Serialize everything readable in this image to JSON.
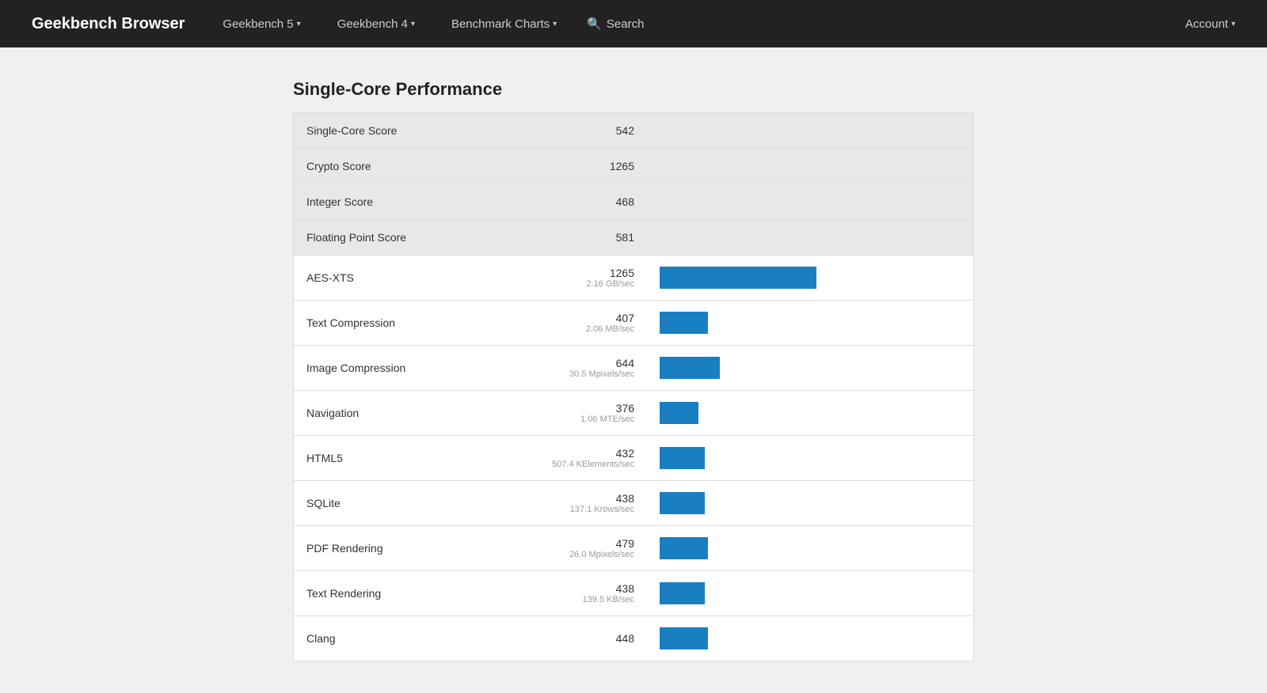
{
  "navbar": {
    "brand": "Geekbench Browser",
    "items": [
      {
        "id": "geekbench5",
        "label": "Geekbench 5",
        "hasDropdown": true
      },
      {
        "id": "geekbench4",
        "label": "Geekbench 4",
        "hasDropdown": true
      },
      {
        "id": "benchmark-charts",
        "label": "Benchmark Charts",
        "hasDropdown": true
      }
    ],
    "search_label": "Search",
    "account_label": "Account"
  },
  "section": {
    "title": "Single-Core Performance"
  },
  "summary_rows": [
    {
      "name": "Single-Core Score",
      "score": "542",
      "unit": ""
    },
    {
      "name": "Crypto Score",
      "score": "1265",
      "unit": ""
    },
    {
      "name": "Integer Score",
      "score": "468",
      "unit": ""
    },
    {
      "name": "Floating Point Score",
      "score": "581",
      "unit": ""
    }
  ],
  "detail_rows": [
    {
      "name": "AES-XTS",
      "score": "1265",
      "unit": "2.16 GB/sec",
      "bar_pct": 52
    },
    {
      "name": "Text Compression",
      "score": "407",
      "unit": "2.06 MB/sec",
      "bar_pct": 16
    },
    {
      "name": "Image Compression",
      "score": "644",
      "unit": "30.5 Mpixels/sec",
      "bar_pct": 20
    },
    {
      "name": "Navigation",
      "score": "376",
      "unit": "1.06 MTE/sec",
      "bar_pct": 13
    },
    {
      "name": "HTML5",
      "score": "432",
      "unit": "507.4 KElements/sec",
      "bar_pct": 15
    },
    {
      "name": "SQLite",
      "score": "438",
      "unit": "137.1 Krows/sec",
      "bar_pct": 15
    },
    {
      "name": "PDF Rendering",
      "score": "479",
      "unit": "26.0 Mpixels/sec",
      "bar_pct": 16
    },
    {
      "name": "Text Rendering",
      "score": "438",
      "unit": "139.5 KB/sec",
      "bar_pct": 15
    },
    {
      "name": "Clang",
      "score": "448",
      "unit": "",
      "bar_pct": 16
    }
  ]
}
